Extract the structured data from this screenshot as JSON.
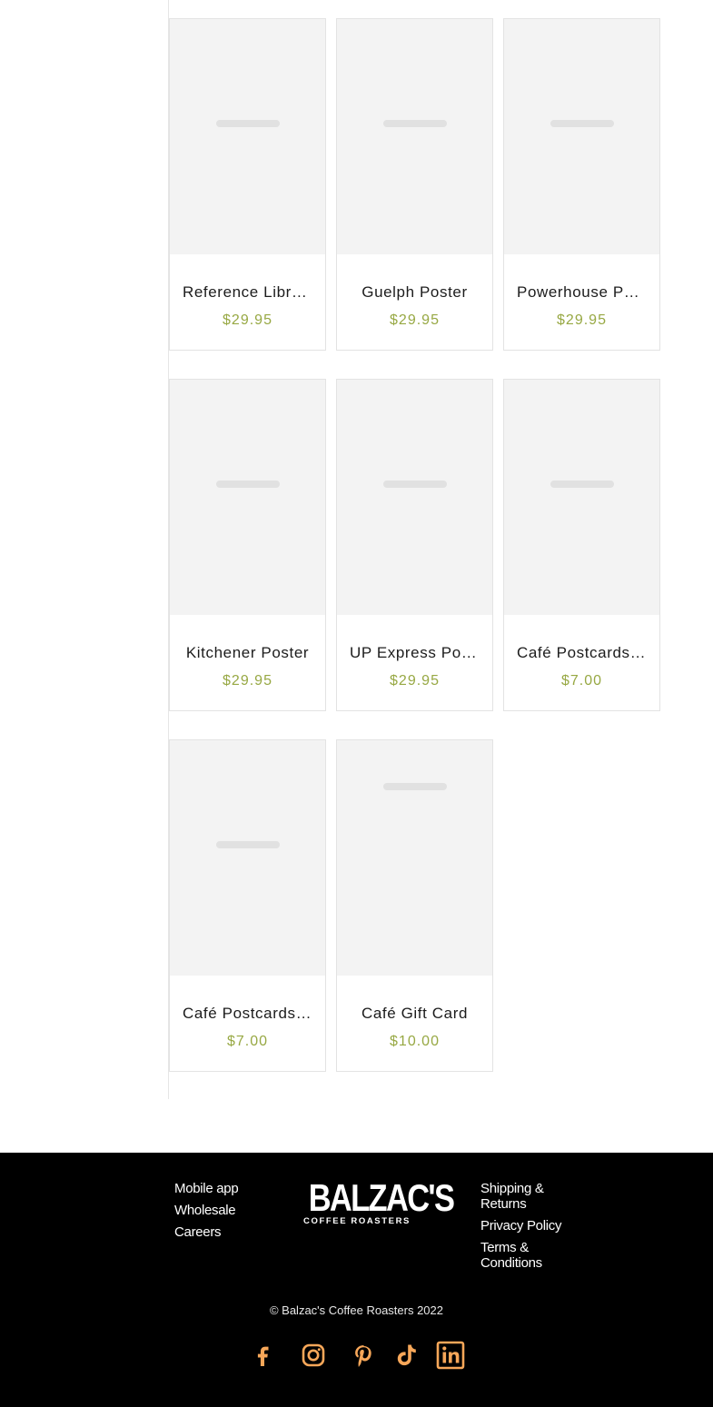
{
  "products": [
    {
      "name": "Reference Library Poster",
      "display_name": "Reference Libra...",
      "price": "$29.95"
    },
    {
      "name": "Guelph Poster",
      "display_name": "Guelph Poster",
      "price": "$29.95"
    },
    {
      "name": "Powerhouse Poster",
      "display_name": "Powerhouse Pos...",
      "price": "$29.95"
    },
    {
      "name": "Kitchener Poster",
      "display_name": "Kitchener Poster",
      "price": "$29.95"
    },
    {
      "name": "UP Express Poster",
      "display_name": "UP Express Poster",
      "price": "$29.95"
    },
    {
      "name": "Café Postcards",
      "display_name": "Café Postcards ...",
      "price": "$7.00"
    },
    {
      "name": "Café Postcards",
      "display_name": "Café Postcards ...",
      "price": "$7.00"
    },
    {
      "name": "Café Gift Card",
      "display_name": "Café Gift Card",
      "price": "$10.00"
    }
  ],
  "footer": {
    "left_links": [
      "Mobile app",
      "Wholesale",
      "Careers"
    ],
    "right_links": [
      "Shipping & Returns",
      "Privacy Policy",
      "Terms & Conditions"
    ],
    "logo": {
      "word": "BALZAC'S",
      "sub": "COFFEE ROASTERS"
    },
    "copyright": "© Balzac's Coffee Roasters 2022",
    "social_icons": [
      "facebook-icon",
      "instagram-icon",
      "pinterest-icon",
      "tiktok-icon",
      "linkedin-icon"
    ],
    "social_color": "#f7a759"
  },
  "colors": {
    "price": "#97a843",
    "placeholder": "#f3f3f3",
    "footer_bg": "#000000"
  }
}
